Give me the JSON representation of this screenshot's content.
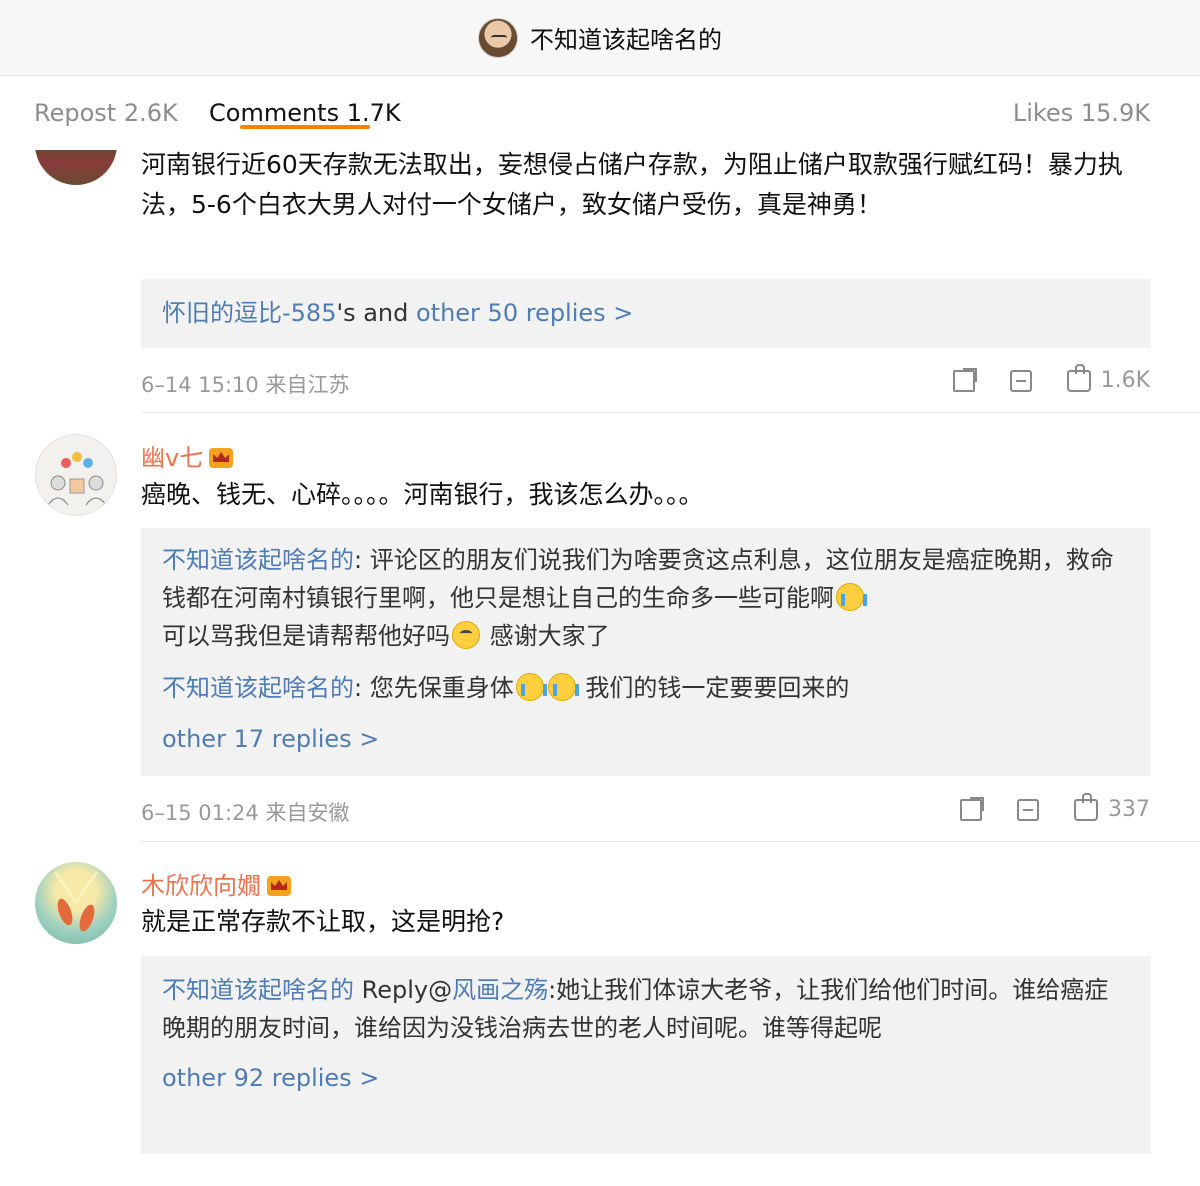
{
  "header": {
    "title": "不知道该起啥名的"
  },
  "tabs": {
    "repost": "Repost 2.6K",
    "comments": "Comments 1.7K",
    "likes": "Likes 15.9K"
  },
  "comments": [
    {
      "text": "河南银行近60天存款无法取出，妄想侵占储户存款，为阻止储户取款强行赋红码！暴力执法，5-6个白衣大男人对付一个女储户，致女储户受伤，真是神勇！",
      "reply_user": "怀旧的逗比-585",
      "reply_mid": "'s and ",
      "reply_more": "other 50 replies >",
      "time": "6–14 15:10 来自江苏",
      "likes": "1.6K"
    },
    {
      "username": "幽v七",
      "text": "癌晚、钱无、心碎。。。。河南银行，我该怎么办。。。",
      "replies": [
        {
          "user": "不知道该起啥名的",
          "part1": ": 评论区的朋友们说我们为啥要贪这点利息，这位朋友是癌症晚期，救命钱都在河南村镇银行里啊，他只是想让自己的生命多一些可能啊",
          "part2": "可以骂我但是请帮帮他好吗",
          "part3": " 感谢大家了"
        },
        {
          "user": "不知道该起啥名的",
          "part1": ": 您先保重身体",
          "part2": " 我们的钱一定要要回来的"
        }
      ],
      "more": "other 17 replies >",
      "time": "6–15 01:24 来自安徽",
      "likes": "337"
    },
    {
      "username": "木欣欣向嫺",
      "text": "就是正常存款不让取，这是明抢?",
      "reply_user": "不知道该起啥名的",
      "reply_label": " Reply@",
      "reply_target": "风画之殇",
      "reply_text": ":她让我们体谅大老爷，让我们给他们时间。谁给癌症晚期的朋友时间，谁给因为没钱治病去世的老人时间呢。谁等得起呢",
      "more": "other 92 replies >"
    }
  ],
  "icons": [
    "share-icon",
    "comment-icon",
    "like-icon",
    "crown-icon",
    "crying-emoji",
    "eye-roll-emoji"
  ],
  "colors": {
    "accent": "#ff8200",
    "username": "#eb7350",
    "link": "#4f7db3"
  }
}
